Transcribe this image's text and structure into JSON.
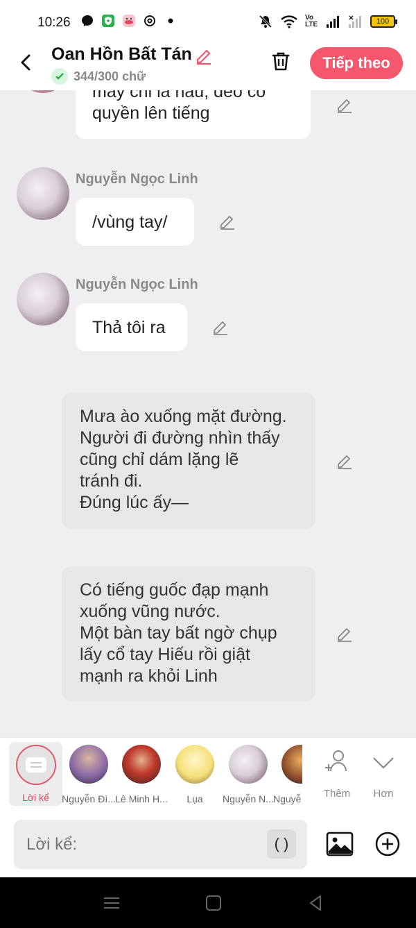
{
  "status_bar": {
    "time": "10:26",
    "network_label": "Vo\nLTE",
    "battery": "100",
    "icons": [
      "messenger-icon",
      "shield-app-icon",
      "face-app-icon",
      "threads-icon",
      "dot-icon",
      "mute-bell-icon",
      "wifi-icon",
      "signal-icon",
      "signal-icon-2"
    ]
  },
  "header": {
    "title": "Oan Hồn Bất Tán",
    "word_count": "344/300 chữ",
    "next_label": "Tiếp theo",
    "accent": "#f5576c"
  },
  "messages": [
    {
      "kind": "dialogue",
      "line1": "may chi la hau, deo co",
      "line2": "quyền lên tiếng"
    },
    {
      "kind": "dialogue",
      "speaker": "Nguyễn Ngọc Linh",
      "text": "/vùng tay/"
    },
    {
      "kind": "dialogue",
      "speaker": "Nguyễn Ngọc Linh",
      "text": "Thả tôi ra"
    },
    {
      "kind": "narration",
      "lines": [
        "Mưa ào xuống mặt đường.",
        "Người đi đường nhìn thấy",
        "cũng chỉ dám lặng lẽ",
        "tránh đi.",
        "Đúng lúc ấy—"
      ]
    },
    {
      "kind": "narration",
      "lines": [
        "Có tiếng guốc đạp mạnh",
        "xuống vũng nước.",
        "Một bàn tay bất ngờ chụp",
        "lấy cổ tay Hiếu rồi giật",
        "mạnh ra khỏi Linh"
      ]
    }
  ],
  "character_bar": {
    "narrator_label": "Lời kể",
    "characters": [
      {
        "label": "Nguyễn Đì..."
      },
      {
        "label": "Lê Minh H..."
      },
      {
        "label": "Lụa"
      },
      {
        "label": "Nguyễn N..."
      },
      {
        "label": "Nguyễ"
      }
    ],
    "add_label": "Thêm",
    "more_label": "Hơn"
  },
  "input": {
    "placeholder": "Lời kể:",
    "paren_label": "( )"
  }
}
